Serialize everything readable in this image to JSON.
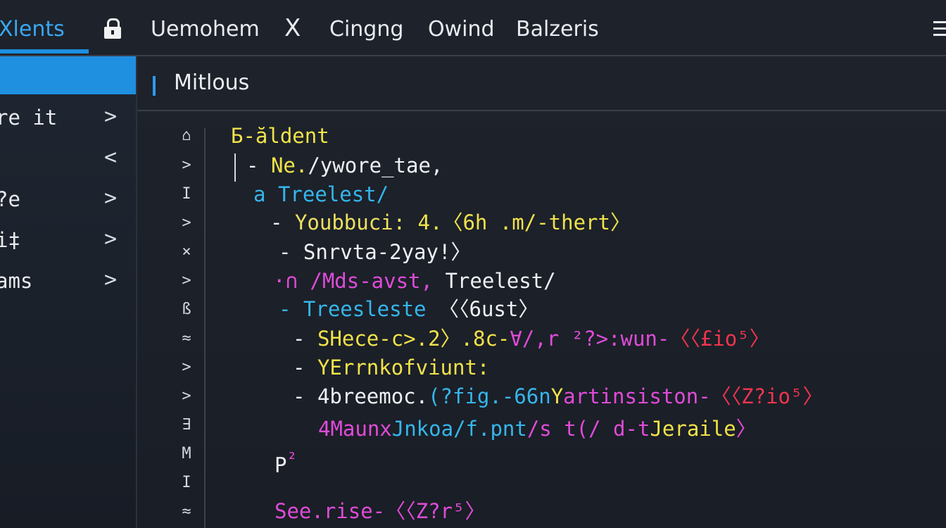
{
  "tabs": [
    {
      "label": "Xlents"
    },
    {
      "label": "Uemohem"
    },
    {
      "label": "Cingng"
    },
    {
      "label": "Owind"
    },
    {
      "label": "Balzeris"
    }
  ],
  "icons": {
    "lock": "lock-icon",
    "close": "close-icon",
    "menu": "hamburger-menu-icon",
    "chevron_right": "chevron-right-icon",
    "chevron_left": "chevron-left-icon"
  },
  "close_glyph": "X",
  "sidebar": {
    "items": [
      {
        "label": "",
        "chevron": ""
      },
      {
        "label": "re it",
        "chevron": ">"
      },
      {
        "label": "",
        "chevron": "<"
      },
      {
        "label": "?e",
        "chevron": ">"
      },
      {
        "label": "i‡",
        "chevron": ">"
      },
      {
        "label": "ams",
        "chevron": ">"
      }
    ]
  },
  "editor": {
    "title": "Mitlous"
  },
  "gutter": [
    "⌂",
    ">",
    "I",
    ">",
    "×",
    ">",
    "ß",
    "≈",
    ">",
    ">",
    "∃",
    "M",
    "I",
    "≈"
  ],
  "code": {
    "l1": "Б-ăldent",
    "l2_dash": "-",
    "l2_a": "Ne.",
    "l2_b": "/ywore_tae,",
    "l3_a": "a",
    "l3_b": "Treelest/",
    "l4_dash": "-",
    "l4_a": "Youbbuci:",
    "l4_b": "4.〈6h .m/-thert〉",
    "l5": "- Snrvta-2yay!〉",
    "l6_a": "·∩ /Mds-avst,",
    "l6_b": "Treelest/",
    "l7_a": "- Treesleste",
    "l7_b": "〈〈6ust〉",
    "l8_dash": "-",
    "l8_a": "SHece-c>.2〉.8c-",
    "l8_b": "∀/,r ²?",
    "l8_c": ">:wun-",
    "l8_d": "〈〈£io⁵〉",
    "l9_dash": "-",
    "l9_a": "YErrnkofviunt:",
    "l10_dash": "-",
    "l10_a": "4breemoc.",
    "l10_b": "(?fig.-66n",
    "l10_c": "Y",
    "l10_d": "artinsiston-",
    "l10_e": "〈〈Z?io⁵〉",
    "l11_a": "4Maunx",
    "l11_b": "Jnkoa/f.pnt",
    "l11_c": "/s t(/ d-t",
    "l11_d": "Jeraile",
    "l11_e": "〉",
    "l12_a": "P",
    "l12_b": "²",
    "l13_a": "See.rise-",
    "l13_b": "〈〈Z?r⁵〉"
  }
}
